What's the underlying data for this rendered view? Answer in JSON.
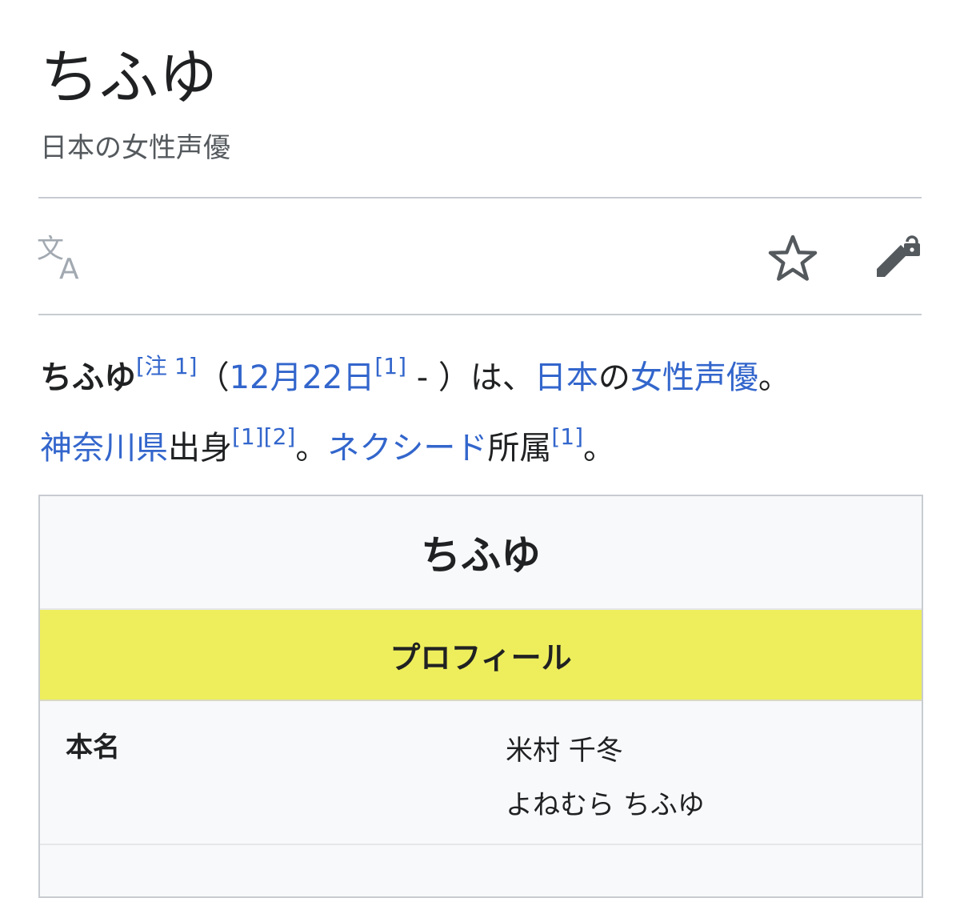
{
  "page": {
    "title": "ちふゆ",
    "description": "日本の女性声優"
  },
  "toolbar": {
    "language_icon": "translate-icon",
    "watch_icon": "star-icon",
    "edit_icon": "edit-locked-icon"
  },
  "lead": {
    "name": "ちふゆ",
    "note_ref": "[注 1]",
    "open_paren": "（",
    "birthday": "12月22日",
    "ref1": "[1]",
    "dash_close": " - ）は、",
    "country": "日本",
    "no": "の",
    "profession": "女性声優",
    "period1": "。",
    "prefecture": "神奈川県",
    "origin": "出身",
    "ref2": "[1]",
    "ref3": "[2]",
    "period2": "。",
    "agency": "ネクシード",
    "affiliation": "所属",
    "ref4": "[1]",
    "period3": "。"
  },
  "infobox": {
    "title": "ちふゆ",
    "section": "プロフィール",
    "rows": [
      {
        "label": "本名",
        "value_line1": "米村 千冬",
        "value_line2": "よねむら ちふゆ"
      }
    ]
  },
  "colors": {
    "link": "#3366cc",
    "section_header_bg": "#eeee5c",
    "infobox_bg": "#f8f9fa",
    "rule": "#c8ccd1"
  }
}
